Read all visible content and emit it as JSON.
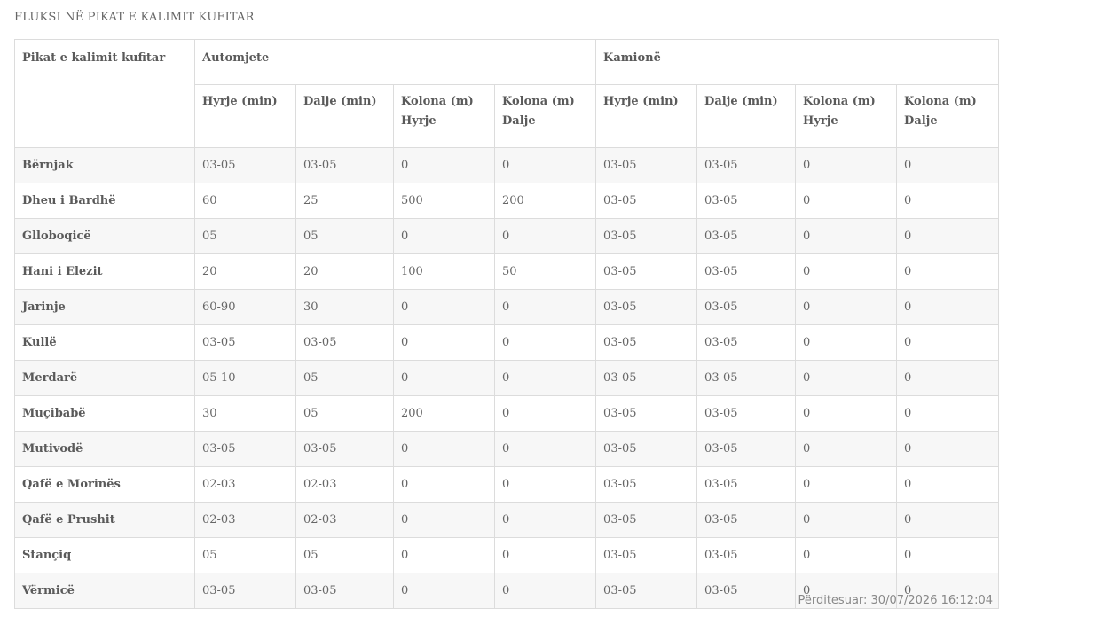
{
  "title": "FLUKSI NË PIKAT E KALIMIT KUFITAR",
  "table": {
    "corner_header": "Pikat e kalimit kufitar",
    "groups": [
      "Automjete",
      "Kamionë"
    ],
    "subheaders": [
      [
        "Hyrje (min)"
      ],
      [
        "Dalje (min)"
      ],
      [
        "Kolona (m)",
        "Hyrje"
      ],
      [
        "Kolona (m)",
        "Dalje"
      ],
      [
        "Hyrje (min)"
      ],
      [
        "Dalje (min)"
      ],
      [
        "Kolona (m)",
        "Hyrje"
      ],
      [
        "Kolona (m)",
        "Dalje"
      ]
    ],
    "rows": [
      {
        "name": "Bërnjak",
        "cells": [
          "03-05",
          "03-05",
          "0",
          "0",
          "03-05",
          "03-05",
          "0",
          "0"
        ]
      },
      {
        "name": "Dheu i Bardhë",
        "cells": [
          "60",
          "25",
          "500",
          "200",
          "03-05",
          "03-05",
          "0",
          "0"
        ]
      },
      {
        "name": "Glloboqicë",
        "cells": [
          "05",
          "05",
          "0",
          "0",
          "03-05",
          "03-05",
          "0",
          "0"
        ]
      },
      {
        "name": "Hani i Elezit",
        "cells": [
          "20",
          "20",
          "100",
          "50",
          "03-05",
          "03-05",
          "0",
          "0"
        ]
      },
      {
        "name": "Jarinje",
        "cells": [
          "60-90",
          "30",
          "0",
          "0",
          "03-05",
          "03-05",
          "0",
          "0"
        ]
      },
      {
        "name": "Kullë",
        "cells": [
          "03-05",
          "03-05",
          "0",
          "0",
          "03-05",
          "03-05",
          "0",
          "0"
        ]
      },
      {
        "name": "Merdarë",
        "cells": [
          "05-10",
          "05",
          "0",
          "0",
          "03-05",
          "03-05",
          "0",
          "0"
        ]
      },
      {
        "name": "Muçibabë",
        "cells": [
          "30",
          "05",
          "200",
          "0",
          "03-05",
          "03-05",
          "0",
          "0"
        ]
      },
      {
        "name": "Mutivodë",
        "cells": [
          "03-05",
          "03-05",
          "0",
          "0",
          "03-05",
          "03-05",
          "0",
          "0"
        ]
      },
      {
        "name": "Qafë e Morinës",
        "cells": [
          "02-03",
          "02-03",
          "0",
          "0",
          "03-05",
          "03-05",
          "0",
          "0"
        ]
      },
      {
        "name": "Qafë e Prushit",
        "cells": [
          "02-03",
          "02-03",
          "0",
          "0",
          "03-05",
          "03-05",
          "0",
          "0"
        ]
      },
      {
        "name": "Stançiq",
        "cells": [
          "05",
          "05",
          "0",
          "0",
          "03-05",
          "03-05",
          "0",
          "0"
        ]
      },
      {
        "name": "Vërmicë",
        "cells": [
          "03-05",
          "03-05",
          "0",
          "0",
          "03-05",
          "03-05",
          "0",
          "0"
        ]
      }
    ]
  },
  "updated": "Përditesuar: 30/07/2026 16:12:04"
}
